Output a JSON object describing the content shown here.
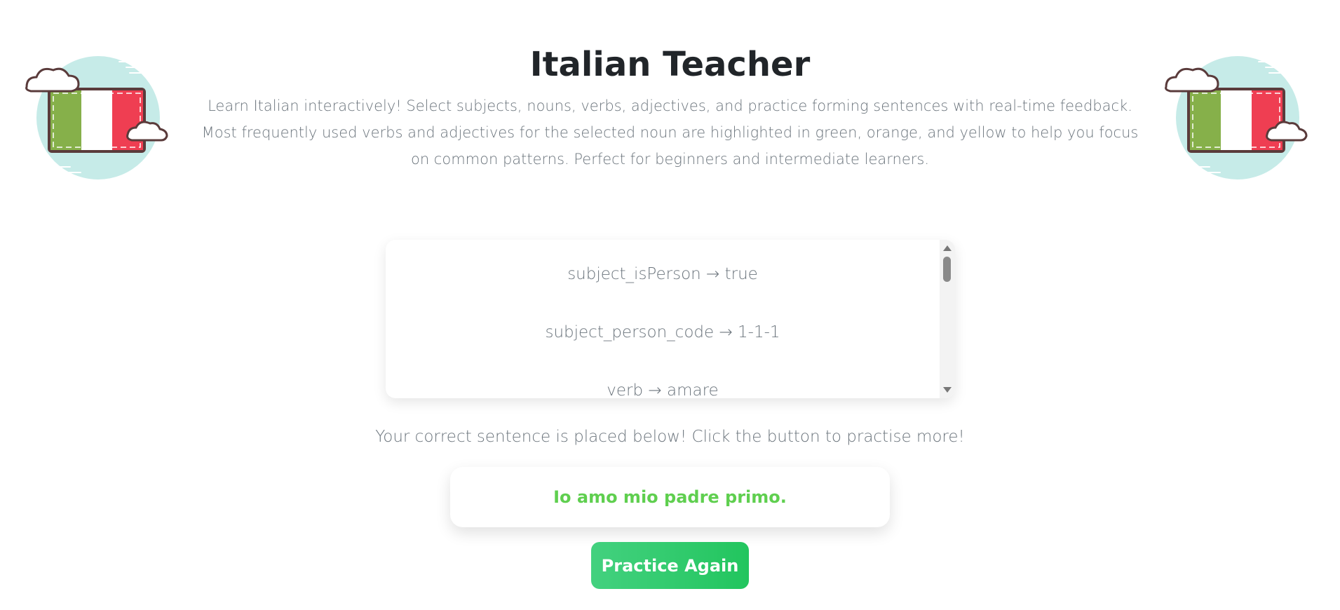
{
  "header": {
    "title": "Italian Teacher",
    "description": "Learn Italian interactively! Select subjects, nouns, verbs, adjectives, and practice forming sentences with real-time feedback. Most frequently used verbs and adjectives for the selected noun are highlighted in green, orange, and yellow to help you focus on common patterns. Perfect for beginners and intermediate learners."
  },
  "illustrations": {
    "left": "italian-flag-cloud-icon",
    "right": "italian-flag-cloud-icon"
  },
  "log": {
    "items": [
      "subject_isPerson → true",
      "subject_person_code → 1-1-1",
      "verb → amare"
    ]
  },
  "result": {
    "info": "Your correct sentence is placed below! Click the button to practise more!",
    "sentence": "Io amo mio padre primo.",
    "sentence_color": "#5fcf4f"
  },
  "actions": {
    "practice_label": "Practice Again",
    "button_color": "#22c55e"
  },
  "colors": {
    "flag_green": "#86b04a",
    "flag_white": "#ffffff",
    "flag_red": "#ef3e52",
    "cloud_bg": "#c6ebe8"
  }
}
